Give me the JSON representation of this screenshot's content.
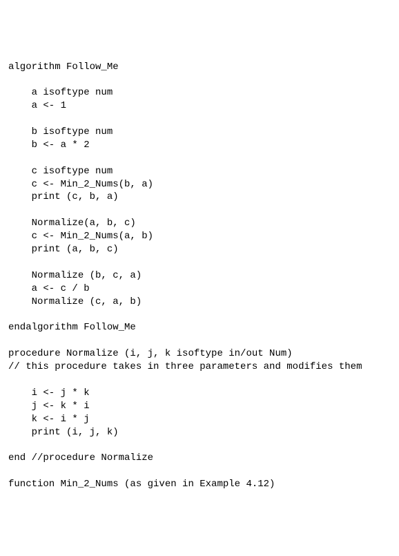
{
  "code": {
    "l01": "algorithm Follow_Me",
    "l02": "",
    "l03": "    a isoftype num",
    "l04": "    a <- 1",
    "l05": "",
    "l06": "    b isoftype num",
    "l07": "    b <- a * 2",
    "l08": "",
    "l09": "    c isoftype num",
    "l10": "    c <- Min_2_Nums(b, a)",
    "l11": "    print (c, b, a)",
    "l12": "",
    "l13": "    Normalize(a, b, c)",
    "l14": "    c <- Min_2_Nums(a, b)",
    "l15": "    print (a, b, c)",
    "l16": "",
    "l17": "    Normalize (b, c, a)",
    "l18": "    a <- c / b",
    "l19": "    Normalize (c, a, b)",
    "l20": "",
    "l21": "endalgorithm Follow_Me",
    "l22": "",
    "l23": "procedure Normalize (i, j, k isoftype in/out Num)",
    "l24": "// this procedure takes in three parameters and modifies them",
    "l25": "",
    "l26": "    i <- j * k",
    "l27": "    j <- k * i",
    "l28": "    k <- i * j",
    "l29": "    print (i, j, k)",
    "l30": "",
    "l31": "end //procedure Normalize",
    "l32": "",
    "l33": "function Min_2_Nums (as given in Example 4.12)"
  }
}
